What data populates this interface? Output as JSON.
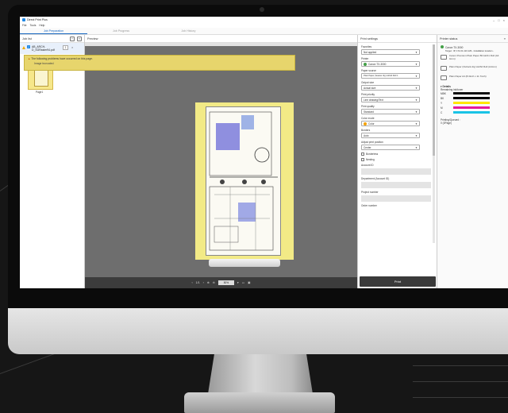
{
  "window": {
    "title": "Direct Print Plus"
  },
  "menu": [
    "File",
    "Tools",
    "Help"
  ],
  "tabs": [
    "Job Preparation",
    "Job Progress",
    "Job History"
  ],
  "job_list": {
    "header": "Job list",
    "job_name": "AB_ARCH-D_SGRaster94.pdf",
    "copies": "1",
    "group_label": "Page1",
    "sheet_label": "Sheet",
    "thumb_caption": "Page1"
  },
  "preview": {
    "header": "Preview",
    "warning": "The following problems have occurred on this page.",
    "warning_detail": "Image truncated",
    "page_indicator": "1/1",
    "zoom": "50%"
  },
  "settings": {
    "header": "Print settings",
    "favorites_label": "Favorites",
    "favorites_value": "Not applied",
    "printer_label": "Printer",
    "printer_value": "Canon TX-3000",
    "paper_source_label": "Paper source",
    "paper_source_value": "Plain Paper (heavier dty) A2/A0 Roll 1",
    "output_size_label": "Output size",
    "output_size_value": "Actual size",
    "priority_label": "Print priority",
    "priority_value": "Line drawing/Text",
    "quality_label": "Print quality",
    "quality_value": "Standard",
    "color_label": "Color mode",
    "color_value": "Color",
    "margin_label": "Borders",
    "margin_value": "Auto",
    "position_label": "Adjust print position",
    "position_value": "Center",
    "borderless": "Borderless",
    "nesting": "Nesting",
    "account_id": "Account ID",
    "department": "Department (Account ID)",
    "project": "Project number",
    "order": "Order number",
    "print_button": "Print"
  },
  "status": {
    "header": "Printer status",
    "printer_name": "Canon TX-3000",
    "printer_target": "Target : IP, 172.21.113.129 - Installation location -",
    "media": [
      "Canon Premium Plain Paper 80 A2/A1 Roll (A4 4mm)",
      "Plain Paper (Outlock dty) A2/A0 Roll (A4mm)",
      "Plain Paper A4 (8.3inch x 11.7inch)"
    ],
    "details_label": "Details",
    "ink_label": "Remaining ink/toner",
    "inks": [
      {
        "name": "MBK",
        "color": "#111111"
      },
      {
        "name": "BK",
        "color": "#000000"
      },
      {
        "name": "Y",
        "color": "#ffe600"
      },
      {
        "name": "M",
        "color": "#e6199b"
      },
      {
        "name": "C",
        "color": "#19c3e6"
      }
    ],
    "printing_label": "Printing/Queued :",
    "printing_value": "0 (0Page)"
  }
}
